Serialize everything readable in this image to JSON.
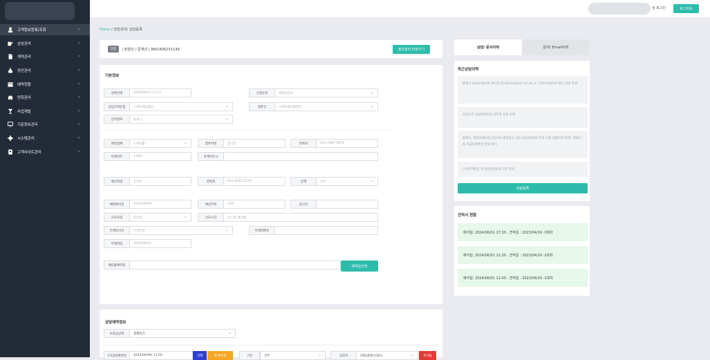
{
  "sidebar": {
    "items": [
      {
        "label": "고객정보등록/조회",
        "icon": "user-icon"
      },
      {
        "label": "상담관리",
        "icon": "pencil-icon"
      },
      {
        "label": "계약관리",
        "icon": "document-icon"
      },
      {
        "label": "정산관리",
        "icon": "money-bag-icon"
      },
      {
        "label": "예약현황",
        "icon": "calendar-icon"
      },
      {
        "label": "연회관리",
        "icon": "car-icon"
      },
      {
        "label": "사업계발",
        "icon": "cocktail-icon"
      },
      {
        "label": "기준정보관리",
        "icon": "monitor-icon"
      },
      {
        "label": "시스템관리",
        "icon": "gear-icon"
      },
      {
        "label": "고객사이트관리",
        "icon": "id-card-icon"
      }
    ],
    "chevron": "›"
  },
  "header": {
    "login_suffix": "님 로그인",
    "logout": "로그아웃"
  },
  "breadcrumb": {
    "home": "Home",
    "sep": "/",
    "path": "상담관리/ 상담등록"
  },
  "consult_header": {
    "badge": "인증",
    "summary": "| 장원진 / 문재선 | RW2406231146",
    "shortcut_button": "정산관리 바로가기"
  },
  "basic_info": {
    "title": "기본정보",
    "labels": {
      "date": "날짜선택",
      "consult_type": "상담고객유형",
      "inflow": "인지경로",
      "sales_lead": "신청순위",
      "manager": "결혼선",
      "hall": "웨딩업체",
      "contact_name": "결혼자명",
      "phone": "연락처",
      "remark": "비케이트",
      "extra": "비케이트시",
      "planner": "예식자명",
      "planner_phone": "연락처",
      "relation": "관계",
      "wedding_date": "예정예식일",
      "guests": "예상하객",
      "food": "음식선",
      "prefer_day": "선호요일",
      "prefer_time": "선호시간",
      "not_contract_reason": "미계약사유",
      "not_contract_note": "미계약메모",
      "not_contract_date": "미계약일",
      "event_reserve": "예의홀예약일"
    },
    "values": {
      "date": "2024/06/12 17:37",
      "consult_type": "스위트웨딩홀안",
      "inflow": "블로그",
      "sales_lead": "예정된안내",
      "manager": "스위트웨딩홀관리",
      "hall": "스위트홀",
      "contact_name": "장기양",
      "phone": "010-1987-5875",
      "remark": "1,000",
      "extra": "",
      "planner": "신기주",
      "planner_phone": "010-8287-1276",
      "relation": "신부",
      "wedding_date": "2024/06/09",
      "guests": "250",
      "food": "",
      "prefer_day": "토요일",
      "prefer_time": "11:30 예식홀",
      "not_contract_reason": "가격부담",
      "not_contract_note": "",
      "not_contract_date": "2023/06/16",
      "event_reserve": ""
    },
    "event_button": "예약일선택"
  },
  "reservation": {
    "title": "상담예약정보",
    "status_label": "보증금상태",
    "status_value": "결제대기",
    "row": {
      "label": "1차상담예약일",
      "value": "2024/06/06/ 11:00",
      "btn_select": "선택",
      "btn_confirm": "예 확인됨",
      "type_label": "구분",
      "type_value": "신부",
      "manager_label": "상담자",
      "manager_value": "[웨딩플래너]정시",
      "btn_add": "추가됨"
    }
  },
  "right_panel": {
    "tabs": [
      "상담/ 문서이력",
      "문자/ Email이력"
    ],
    "recent_title": "최근상담이력",
    "history": [
      "플래너 2024/06/30 계시마 대 2024/06/30 15:30 시 / 2023/06/16 예시 일정 변경",
      "신랑신부 상담예약일정 내부의 의견 반영",
      "플래너, 계로자별보증신청서와 예약상시 신랑 2024/06/0 주종 신청 상황으로 합계, 지배이후 지금입력예상 완료 알이",
      "[스위트웨딩] 계 상담작성요청 신부 중요"
    ],
    "consult_button": "상담등록",
    "estimate_title": "견적서 현황",
    "estimates": [
      "예식일: 2024/06/01 17:30 , 견적일 : 2023/04/16 -3회차",
      "예식일: 2024/06/01 11:30 , 견적일 : 2023/04/16 -2회차",
      "예식일: 2024/06/01 11:00 , 견적일 : 2023/04/16 -1회차"
    ]
  },
  "colors": {
    "accent": "#2dbcab",
    "sidebar": "#232b38",
    "estimate_bg": "#e5f8e9",
    "blue": "#2d3fd1",
    "orange": "#f5a623",
    "red": "#e53935"
  }
}
